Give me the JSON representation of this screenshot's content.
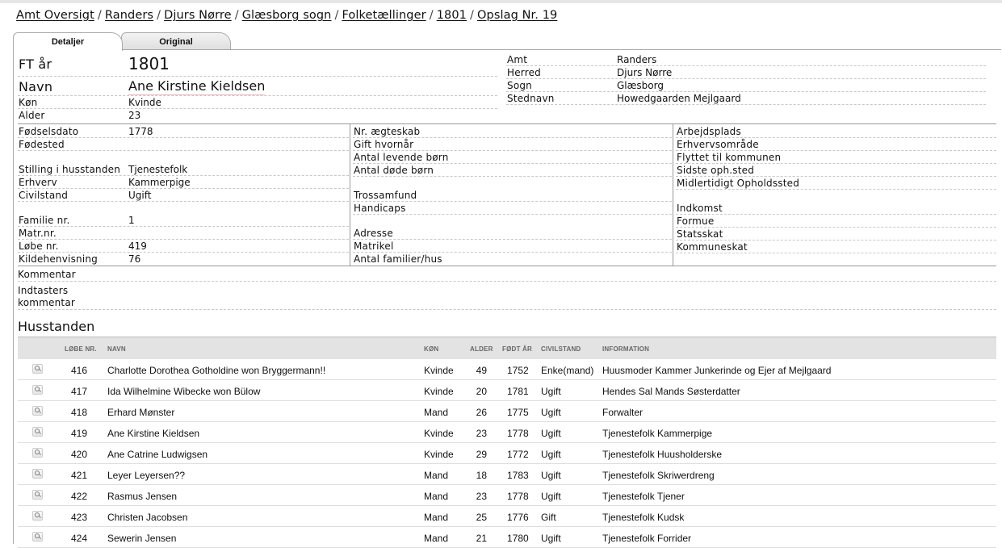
{
  "breadcrumb": [
    "Amt Oversigt",
    "Randers",
    "Djurs Nørre",
    "Glæsborg sogn",
    "Folketællinger",
    "1801",
    "Opslag Nr. 19"
  ],
  "breadcrumb_separator": "/",
  "tabs": {
    "details": "Detaljer",
    "original": "Original"
  },
  "person": {
    "ft_year_label": "FT år",
    "ft_year": "1801",
    "name_label": "Navn",
    "name": "Ane Kirstine Kieldsen",
    "sex_label": "Køn",
    "sex": "Kvinde",
    "age_label": "Alder",
    "age": "23"
  },
  "location": {
    "amt_label": "Amt",
    "amt": "Randers",
    "herred_label": "Herred",
    "herred": "Djurs Nørre",
    "sogn_label": "Sogn",
    "sogn": "Glæsborg",
    "stednavn_label": "Stednavn",
    "stednavn": "Howedgaarden Mejlgaard"
  },
  "col1": {
    "birthdate_label": "Fødselsdato",
    "birthdate": "1778",
    "birthplace_label": "Fødested",
    "position_label": "Stilling i husstanden",
    "position": "Tjenestefolk",
    "occupation_label": "Erhverv",
    "occupation": "Kammerpige",
    "civil_label": "Civilstand",
    "civil": "Ugift",
    "family_label": "Familie nr.",
    "family": "1",
    "matr_label": "Matr.nr.",
    "lobe_label": "Løbe nr.",
    "lobe": "419",
    "kilde_label": "Kildehenvisning",
    "kilde": "76"
  },
  "col2": {
    "marriage_label": "Nr. ægteskab",
    "married_when_label": "Gift hvornår",
    "living_children_label": "Antal levende børn",
    "dead_children_label": "Antal døde børn",
    "religion_label": "Trossamfund",
    "handicap_label": "Handicaps",
    "address_label": "Adresse",
    "matrikel_label": "Matrikel",
    "families_label": "Antal familier/hus"
  },
  "col3": {
    "workplace_label": "Arbejdsplads",
    "sector_label": "Erhvervsområde",
    "moved_label": "Flyttet til kommunen",
    "last_stay_label": "Sidste oph.sted",
    "temp_stay_label": "Midlertidigt Opholdssted",
    "income_label": "Indkomst",
    "wealth_label": "Formue",
    "state_tax_label": "Statsskat",
    "muni_tax_label": "Kommuneskat"
  },
  "comments": {
    "comment_label": "Kommentar",
    "typist_label_1": "Indtasters",
    "typist_label_2": "kommentar"
  },
  "household": {
    "title": "Husstanden",
    "headers": {
      "lobe": "LØBE NR.",
      "name": "NAVN",
      "sex": "KØN",
      "age": "ALDER",
      "born": "FØDT ÅR",
      "civil": "CIVILSTAND",
      "info": "INFORMATION"
    },
    "rows": [
      {
        "lobe": "416",
        "name": "Charlotte Dorothea Gotholdine won Bryggermann!!",
        "sex": "Kvinde",
        "age": "49",
        "born": "1752",
        "civil": "Enke(mand)",
        "info": "Huusmoder Kammer Junkerinde og Ejer af Mejlgaard"
      },
      {
        "lobe": "417",
        "name": "Ida Wilhelmine Wibecke won Bülow",
        "sex": "Kvinde",
        "age": "20",
        "born": "1781",
        "civil": "Ugift",
        "info": "Hendes Sal Mands Søsterdatter"
      },
      {
        "lobe": "418",
        "name": "Erhard Mønster",
        "sex": "Mand",
        "age": "26",
        "born": "1775",
        "civil": "Ugift",
        "info": "Forwalter"
      },
      {
        "lobe": "419",
        "name": "Ane Kirstine Kieldsen",
        "sex": "Kvinde",
        "age": "23",
        "born": "1778",
        "civil": "Ugift",
        "info": "Tjenestefolk Kammerpige"
      },
      {
        "lobe": "420",
        "name": "Ane Catrine Ludwigsen",
        "sex": "Kvinde",
        "age": "29",
        "born": "1772",
        "civil": "Ugift",
        "info": "Tjenestefolk Huusholderske"
      },
      {
        "lobe": "421",
        "name": "Leyer Leyersen??",
        "sex": "Mand",
        "age": "18",
        "born": "1783",
        "civil": "Ugift",
        "info": "Tjenestefolk Skriwerdreng"
      },
      {
        "lobe": "422",
        "name": "Rasmus Jensen",
        "sex": "Mand",
        "age": "23",
        "born": "1778",
        "civil": "Ugift",
        "info": "Tjenestefolk Tjener"
      },
      {
        "lobe": "423",
        "name": "Christen Jacobsen",
        "sex": "Mand",
        "age": "25",
        "born": "1776",
        "civil": "Gift",
        "info": "Tjenestefolk Kudsk"
      },
      {
        "lobe": "424",
        "name": "Sewerin Jensen",
        "sex": "Mand",
        "age": "21",
        "born": "1780",
        "civil": "Ugift",
        "info": "Tjenestefolk Forrider"
      }
    ]
  }
}
